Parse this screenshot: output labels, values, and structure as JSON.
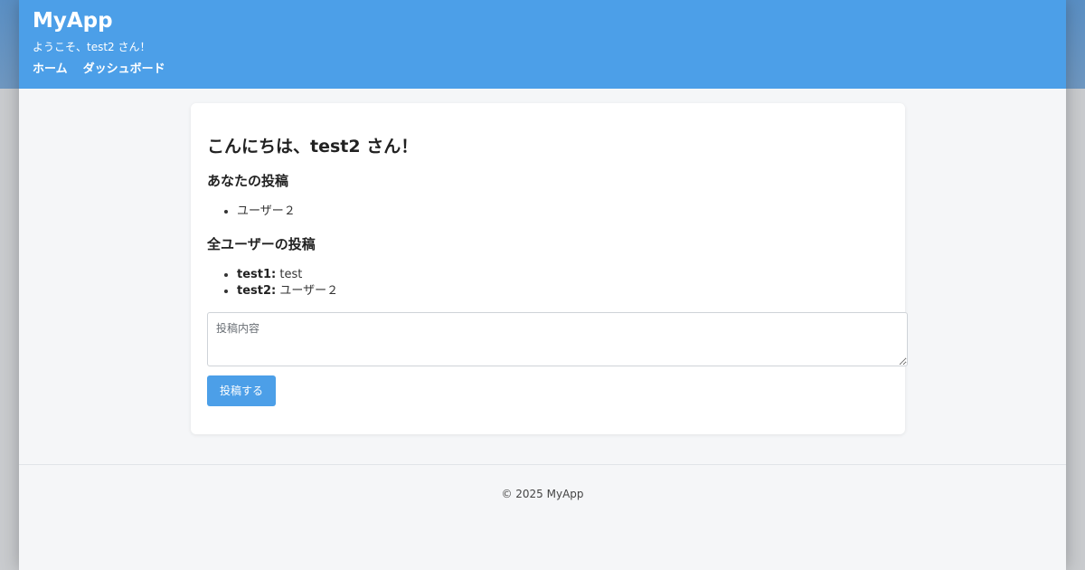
{
  "header": {
    "brand": "MyApp",
    "welcome": "ようこそ、test2 さん！",
    "nav": [
      "ホーム",
      "ダッシュボード"
    ]
  },
  "main": {
    "greeting": "こんにちは、test2 さん！",
    "my_posts_heading": "あなたの投稿",
    "my_posts": [
      "ユーザー２"
    ],
    "all_posts_heading": "全ユーザーの投稿",
    "all_posts": [
      {
        "user": "test1:",
        "content": "test"
      },
      {
        "user": "test2:",
        "content": "ユーザー２"
      }
    ],
    "post_placeholder": "投稿内容",
    "submit_label": "投稿する"
  },
  "footer": {
    "copyright": "© 2025 MyApp"
  },
  "colors": {
    "accent": "#4c9fe8",
    "background": "#f5f6f8"
  }
}
